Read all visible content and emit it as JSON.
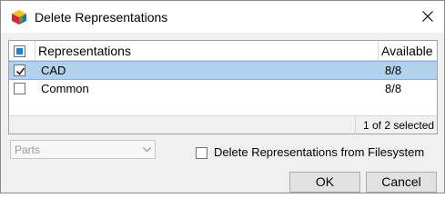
{
  "window": {
    "title": "Delete Representations"
  },
  "table": {
    "headers": {
      "representations": "Representations",
      "available": "Available"
    },
    "rows": [
      {
        "name": "CAD",
        "available": "8/8",
        "checked": true,
        "selected": true
      },
      {
        "name": "Common",
        "available": "8/8",
        "checked": false,
        "selected": false
      }
    ],
    "status": "1 of 2 selected"
  },
  "filter": {
    "value": "Parts"
  },
  "options": {
    "delete_from_fs_label": "Delete Representations from Filesystem"
  },
  "buttons": {
    "ok": "OK",
    "cancel": "Cancel"
  },
  "colors": {
    "selection": "#b2d1ed",
    "accent": "#1e7fd6"
  },
  "icons": {
    "app": "cube-icon",
    "close": "close-icon",
    "checkmark": "checkmark-icon",
    "dropdown": "chevron-down-icon"
  }
}
